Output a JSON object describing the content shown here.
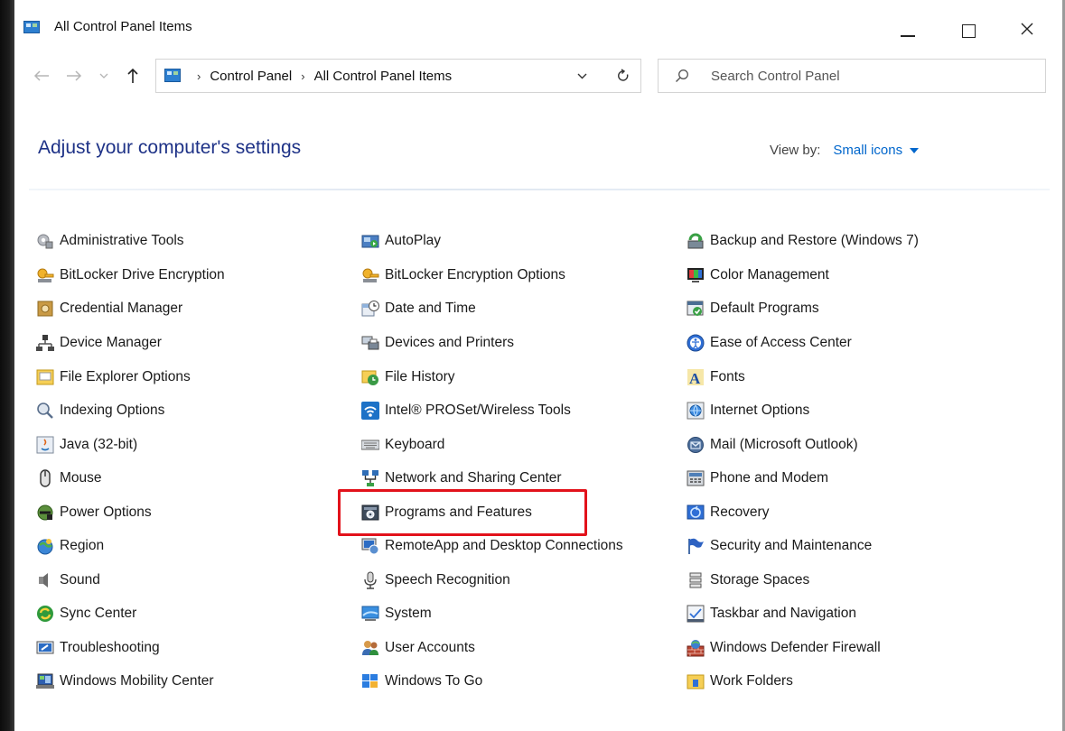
{
  "window": {
    "title": "All Control Panel Items"
  },
  "navigation": {
    "breadcrumb": [
      "Control Panel",
      "All Control Panel Items"
    ],
    "search_placeholder": "Search Control Panel"
  },
  "header": {
    "title": "Adjust your computer's settings",
    "view_by_label": "View by:",
    "view_by_value": "Small icons"
  },
  "items": [
    {
      "label": "Administrative Tools",
      "icon": "admin-tools-icon"
    },
    {
      "label": "AutoPlay",
      "icon": "autoplay-icon"
    },
    {
      "label": "Backup and Restore (Windows 7)",
      "icon": "backup-restore-icon"
    },
    {
      "label": "BitLocker Drive Encryption",
      "icon": "bitlocker-icon"
    },
    {
      "label": "BitLocker Encryption Options",
      "icon": "bitlocker-options-icon"
    },
    {
      "label": "Color Management",
      "icon": "color-management-icon"
    },
    {
      "label": "Credential Manager",
      "icon": "credential-manager-icon"
    },
    {
      "label": "Date and Time",
      "icon": "date-time-icon"
    },
    {
      "label": "Default Programs",
      "icon": "default-programs-icon"
    },
    {
      "label": "Device Manager",
      "icon": "device-manager-icon"
    },
    {
      "label": "Devices and Printers",
      "icon": "devices-printers-icon"
    },
    {
      "label": "Ease of Access Center",
      "icon": "ease-of-access-icon"
    },
    {
      "label": "File Explorer Options",
      "icon": "file-explorer-options-icon"
    },
    {
      "label": "File History",
      "icon": "file-history-icon"
    },
    {
      "label": "Fonts",
      "icon": "fonts-icon"
    },
    {
      "label": "Indexing Options",
      "icon": "indexing-options-icon"
    },
    {
      "label": "Intel® PROSet/Wireless Tools",
      "icon": "wireless-icon"
    },
    {
      "label": "Internet Options",
      "icon": "internet-options-icon"
    },
    {
      "label": "Java (32-bit)",
      "icon": "java-icon"
    },
    {
      "label": "Keyboard",
      "icon": "keyboard-icon"
    },
    {
      "label": "Mail (Microsoft Outlook)",
      "icon": "mail-icon"
    },
    {
      "label": "Mouse",
      "icon": "mouse-icon"
    },
    {
      "label": "Network and Sharing Center",
      "icon": "network-icon"
    },
    {
      "label": "Phone and Modem",
      "icon": "phone-modem-icon"
    },
    {
      "label": "Power Options",
      "icon": "power-options-icon"
    },
    {
      "label": "Programs and Features",
      "icon": "programs-features-icon"
    },
    {
      "label": "Recovery",
      "icon": "recovery-icon"
    },
    {
      "label": "Region",
      "icon": "region-icon"
    },
    {
      "label": "RemoteApp and Desktop Connections",
      "icon": "remoteapp-icon"
    },
    {
      "label": "Security and Maintenance",
      "icon": "security-flag-icon"
    },
    {
      "label": "Sound",
      "icon": "sound-icon"
    },
    {
      "label": "Speech Recognition",
      "icon": "microphone-icon"
    },
    {
      "label": "Storage Spaces",
      "icon": "storage-spaces-icon"
    },
    {
      "label": "Sync Center",
      "icon": "sync-center-icon"
    },
    {
      "label": "System",
      "icon": "system-icon"
    },
    {
      "label": "Taskbar and Navigation",
      "icon": "taskbar-icon"
    },
    {
      "label": "Troubleshooting",
      "icon": "troubleshooting-icon"
    },
    {
      "label": "User Accounts",
      "icon": "user-accounts-icon"
    },
    {
      "label": "Windows Defender Firewall",
      "icon": "firewall-icon"
    },
    {
      "label": "Windows Mobility Center",
      "icon": "mobility-center-icon"
    },
    {
      "label": "Windows To Go",
      "icon": "windows-to-go-icon"
    },
    {
      "label": "Work Folders",
      "icon": "work-folders-icon"
    }
  ],
  "highlighted_item": "Programs and Features",
  "colors": {
    "title_blue": "#1e3287",
    "link_blue": "#0066cc",
    "highlight_red": "#e2121b"
  }
}
